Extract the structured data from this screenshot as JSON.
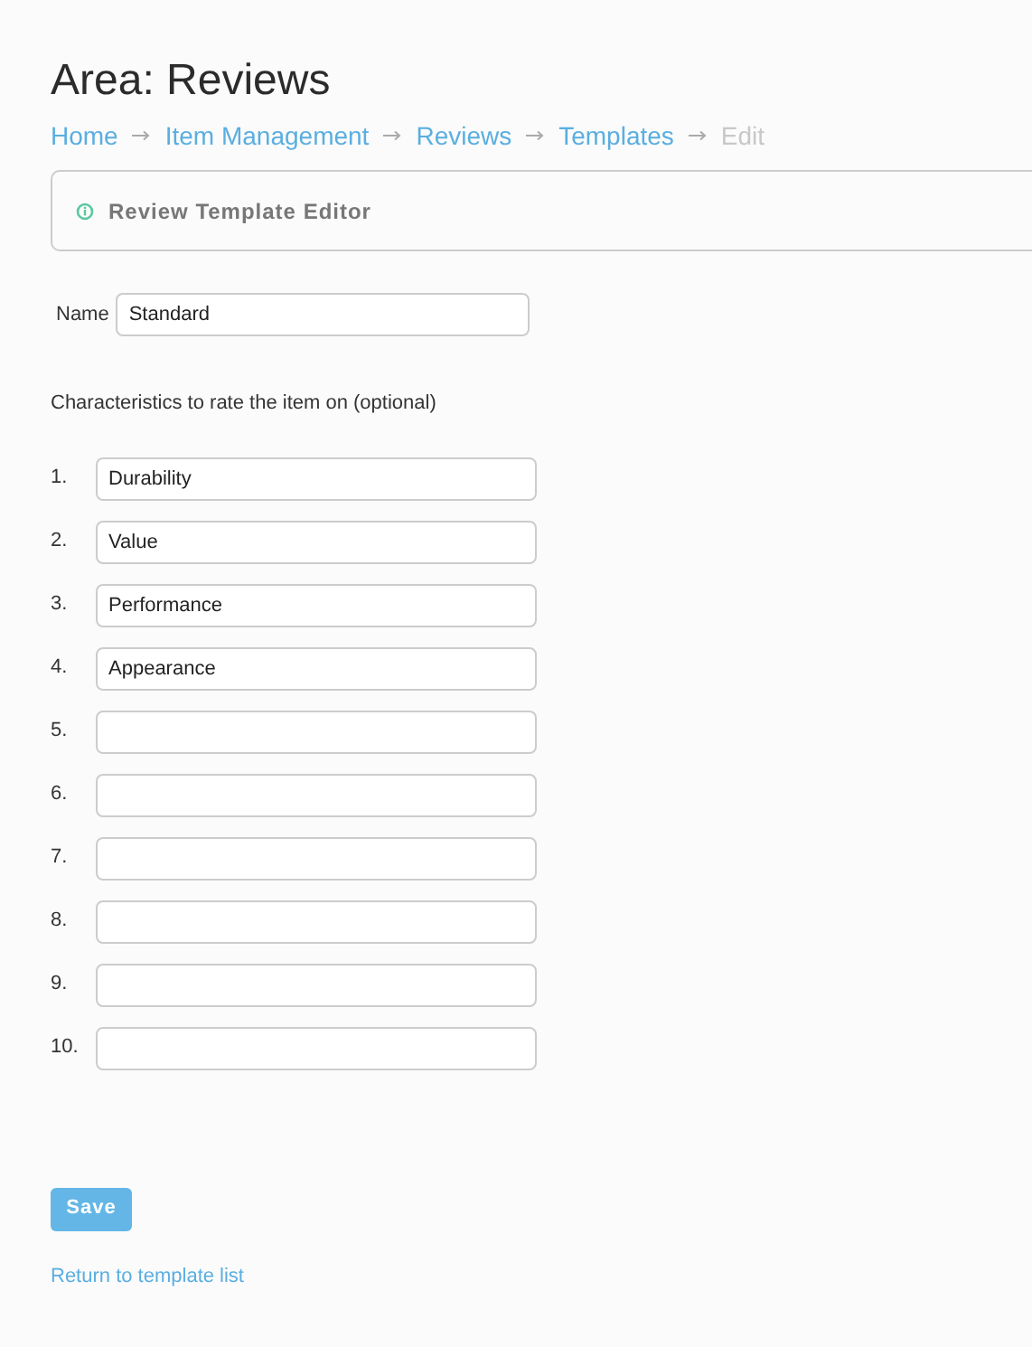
{
  "title": "Area: Reviews",
  "breadcrumb": [
    {
      "label": "Home",
      "current": false
    },
    {
      "label": "Item Management",
      "current": false
    },
    {
      "label": "Reviews",
      "current": false
    },
    {
      "label": "Templates",
      "current": false
    },
    {
      "label": "Edit",
      "current": true
    }
  ],
  "panel": {
    "title": "Review Template Editor"
  },
  "name_field": {
    "label": "Name",
    "value": "Standard"
  },
  "characteristics_label": "Characteristics to rate the item on (optional)",
  "characteristics": [
    {
      "number": "1.",
      "value": "Durability"
    },
    {
      "number": "2.",
      "value": "Value"
    },
    {
      "number": "3.",
      "value": "Performance"
    },
    {
      "number": "4.",
      "value": "Appearance"
    },
    {
      "number": "5."
    },
    {
      "number": "6."
    },
    {
      "number": "7."
    },
    {
      "number": "8."
    },
    {
      "number": "9."
    },
    {
      "number": "10."
    }
  ],
  "save_button": "Save",
  "return_link": "Return to template list"
}
